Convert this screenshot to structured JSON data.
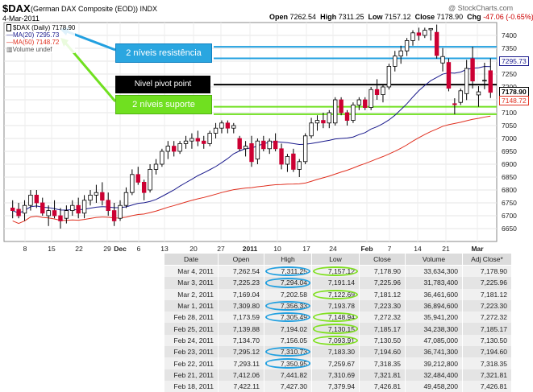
{
  "header": {
    "symbol": "$DAX",
    "description": "(German DAX Composite (EOD))",
    "exchange": "INDX",
    "date": "4-Mar-2011",
    "open_label": "Open",
    "open": "7262.54",
    "high_label": "High",
    "high": "7311.25",
    "low_label": "Low",
    "low": "7157.12",
    "close_label": "Close",
    "close": "7178.90",
    "chg_label": "Chg",
    "chg": "-47.06 (-0.65%)",
    "brand": "@ StockCharts.com"
  },
  "legend": {
    "price": "$DAX (Daily) 7178.90",
    "ma20": "MA(20) 7295.73",
    "ma50": "MA(50) 7148.72",
    "volume": "Volume undef"
  },
  "annotations": {
    "resistance": "2 níveis  resistência",
    "pivot": "Nivel pivot point",
    "support": "2 níveis  suporte"
  },
  "colors": {
    "up": "#ffffff",
    "down": "#cc0033",
    "ma20": "#1a1a8c",
    "ma50": "#e03020",
    "resistance": "#22a0e0",
    "support": "#70e020",
    "pivot": "#000000"
  },
  "chart_data": {
    "type": "candlestick",
    "ylim": [
      6600,
      7450
    ],
    "y_ticks": [
      6650,
      6700,
      6750,
      6800,
      6850,
      6900,
      6950,
      7000,
      7050,
      7100,
      7150,
      7200,
      7250,
      7300,
      7350,
      7400
    ],
    "x_ticks": [
      "8",
      "15",
      "22",
      "29",
      "Dec",
      "6",
      "13",
      "20",
      "27",
      "2011",
      "10",
      "17",
      "24",
      "Feb",
      "7",
      "14",
      "21",
      "Mar"
    ],
    "price_tags": {
      "ma20": "7295.73",
      "close": "7178.90",
      "ma50": "7148.72"
    },
    "horizontal_levels": {
      "resistance": [
        7356,
        7311
      ],
      "pivot": 7209,
      "support": [
        7123,
        7094
      ]
    },
    "candles": [
      [
        6730,
        6760,
        6690,
        6720
      ],
      [
        6725,
        6750,
        6690,
        6700
      ],
      [
        6710,
        6760,
        6680,
        6740
      ],
      [
        6740,
        6800,
        6720,
        6780
      ],
      [
        6780,
        6800,
        6730,
        6750
      ],
      [
        6750,
        6770,
        6700,
        6710
      ],
      [
        6700,
        6740,
        6660,
        6720
      ],
      [
        6720,
        6760,
        6690,
        6700
      ],
      [
        6700,
        6730,
        6650,
        6680
      ],
      [
        6690,
        6740,
        6670,
        6720
      ],
      [
        6720,
        6760,
        6700,
        6740
      ],
      [
        6740,
        6770,
        6690,
        6710
      ],
      [
        6710,
        6780,
        6690,
        6760
      ],
      [
        6760,
        6800,
        6740,
        6780
      ],
      [
        6780,
        6820,
        6750,
        6790
      ],
      [
        6790,
        6830,
        6740,
        6760
      ],
      [
        6760,
        6790,
        6700,
        6720
      ],
      [
        6720,
        6750,
        6660,
        6680
      ],
      [
        6690,
        6760,
        6680,
        6740
      ],
      [
        6740,
        6810,
        6730,
        6790
      ],
      [
        6790,
        6880,
        6780,
        6860
      ],
      [
        6860,
        6890,
        6820,
        6830
      ],
      [
        6830,
        6840,
        6760,
        6790
      ],
      [
        6800,
        6900,
        6790,
        6880
      ],
      [
        6880,
        6920,
        6860,
        6900
      ],
      [
        6900,
        6960,
        6890,
        6950
      ],
      [
        6950,
        6990,
        6920,
        6970
      ],
      [
        6970,
        6990,
        6930,
        6950
      ],
      [
        6950,
        6990,
        6940,
        6980
      ],
      [
        6980,
        7010,
        6960,
        6990
      ],
      [
        6990,
        7020,
        6960,
        7000
      ],
      [
        7000,
        7030,
        6970,
        6990
      ],
      [
        6990,
        7010,
        6960,
        6980
      ],
      [
        6980,
        7030,
        6970,
        7020
      ],
      [
        7020,
        7060,
        7000,
        7040
      ],
      [
        7040,
        7070,
        7020,
        7060
      ],
      [
        7060,
        7070,
        7020,
        7040
      ],
      [
        7040,
        7060,
        7020,
        7050
      ],
      [
        7000,
        7010,
        6950,
        6960
      ],
      [
        6960,
        6990,
        6930,
        6970
      ],
      [
        6980,
        7010,
        6890,
        6910
      ],
      [
        6920,
        7000,
        6900,
        6990
      ],
      [
        6990,
        7010,
        6950,
        6960
      ],
      [
        6960,
        7000,
        6940,
        6990
      ],
      [
        6990,
        7020,
        6950,
        6960
      ],
      [
        6960,
        6980,
        6880,
        6900
      ],
      [
        6900,
        6940,
        6870,
        6930
      ],
      [
        6940,
        6960,
        6870,
        6880
      ],
      [
        6880,
        6920,
        6850,
        6910
      ],
      [
        6910,
        7020,
        6900,
        7010
      ],
      [
        7010,
        7080,
        7000,
        7060
      ],
      [
        7060,
        7090,
        7030,
        7070
      ],
      [
        7070,
        7100,
        7040,
        7060
      ],
      [
        7060,
        7110,
        7040,
        7100
      ],
      [
        7060,
        7160,
        7050,
        7150
      ],
      [
        7150,
        7160,
        7090,
        7100
      ],
      [
        7100,
        7110,
        7050,
        7070
      ],
      [
        7070,
        7140,
        7060,
        7130
      ],
      [
        7130,
        7160,
        7110,
        7150
      ],
      [
        7150,
        7160,
        7110,
        7120
      ],
      [
        7120,
        7200,
        7110,
        7190
      ],
      [
        7190,
        7230,
        7150,
        7170
      ],
      [
        7170,
        7210,
        7140,
        7200
      ],
      [
        7200,
        7290,
        7190,
        7280
      ],
      [
        7280,
        7340,
        7260,
        7320
      ],
      [
        7320,
        7360,
        7290,
        7340
      ],
      [
        7340,
        7390,
        7320,
        7380
      ],
      [
        7380,
        7420,
        7360,
        7410
      ],
      [
        7410,
        7430,
        7380,
        7400
      ],
      [
        7400,
        7430,
        7390,
        7420
      ],
      [
        7422,
        7427,
        7380,
        7427
      ],
      [
        7412,
        7442,
        7310,
        7322
      ],
      [
        7293,
        7351,
        7260,
        7318
      ],
      [
        7295,
        7311,
        7183,
        7195
      ],
      [
        7135,
        7156,
        7094,
        7131
      ],
      [
        7140,
        7194,
        7130,
        7185
      ],
      [
        7174,
        7305,
        7149,
        7272
      ],
      [
        7310,
        7356,
        7194,
        7223
      ],
      [
        7169,
        7203,
        7123,
        7181
      ],
      [
        7225,
        7294,
        7191,
        7226
      ],
      [
        7263,
        7311,
        7157,
        7179
      ]
    ]
  },
  "table": {
    "headers": [
      "Date",
      "Open",
      "High",
      "Low",
      "Close",
      "Volume",
      "Adj Close*"
    ],
    "rows": [
      [
        "Mar 4, 2011",
        "7,262.54",
        "7,311.25",
        "7,157.12",
        "7,178.90",
        "33,634,300",
        "7,178.90"
      ],
      [
        "Mar 3, 2011",
        "7,225.23",
        "7,294.04",
        "7,191.14",
        "7,225.96",
        "31,783,400",
        "7,225.96"
      ],
      [
        "Mar 2, 2011",
        "7,169.04",
        "7,202.58",
        "7,122.69",
        "7,181.12",
        "36,461,600",
        "7,181.12"
      ],
      [
        "Mar 1, 2011",
        "7,309.80",
        "7,356.33",
        "7,193.78",
        "7,223.30",
        "36,894,600",
        "7,223.30"
      ],
      [
        "Feb 28, 2011",
        "7,173.59",
        "7,305.49",
        "7,148.94",
        "7,272.32",
        "35,941,200",
        "7,272.32"
      ],
      [
        "Feb 25, 2011",
        "7,139.88",
        "7,194.02",
        "7,130.15",
        "7,185.17",
        "34,238,300",
        "7,185.17"
      ],
      [
        "Feb 24, 2011",
        "7,134.70",
        "7,156.05",
        "7,093.91",
        "7,130.50",
        "47,085,000",
        "7,130.50"
      ],
      [
        "Feb 23, 2011",
        "7,295.12",
        "7,310.73",
        "7,183.30",
        "7,194.60",
        "36,741,300",
        "7,194.60"
      ],
      [
        "Feb 22, 2011",
        "7,293.11",
        "7,350.95",
        "7,259.67",
        "7,318.35",
        "39,212,800",
        "7,318.35"
      ],
      [
        "Feb 21, 2011",
        "7,412.06",
        "7,441.82",
        "7,310.69",
        "7,321.81",
        "32,484,400",
        "7,321.81"
      ],
      [
        "Feb 18, 2011",
        "7,422.11",
        "7,427.30",
        "7,379.94",
        "7,426.81",
        "49,458,200",
        "7,426.81"
      ]
    ],
    "ring_high_rows": [
      0,
      1,
      3,
      4,
      7,
      8
    ],
    "ring_low_rows": [
      0,
      2,
      4,
      5,
      6
    ]
  }
}
